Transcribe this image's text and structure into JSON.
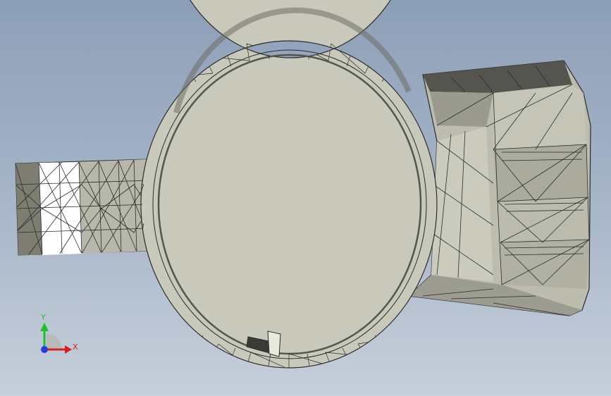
{
  "viewport": {
    "background_top": "#8d9fb8",
    "background_bottom": "#c6cfdb"
  },
  "model": {
    "icon": "meshed-ring-part",
    "face_color": "#c9c9bb",
    "edge_color": "#2b2b2b"
  },
  "triad": {
    "x_label": "X",
    "y_label": "Y",
    "x_color": "#d42020",
    "y_color": "#1fbf2f",
    "z_color": "#2040d8"
  }
}
